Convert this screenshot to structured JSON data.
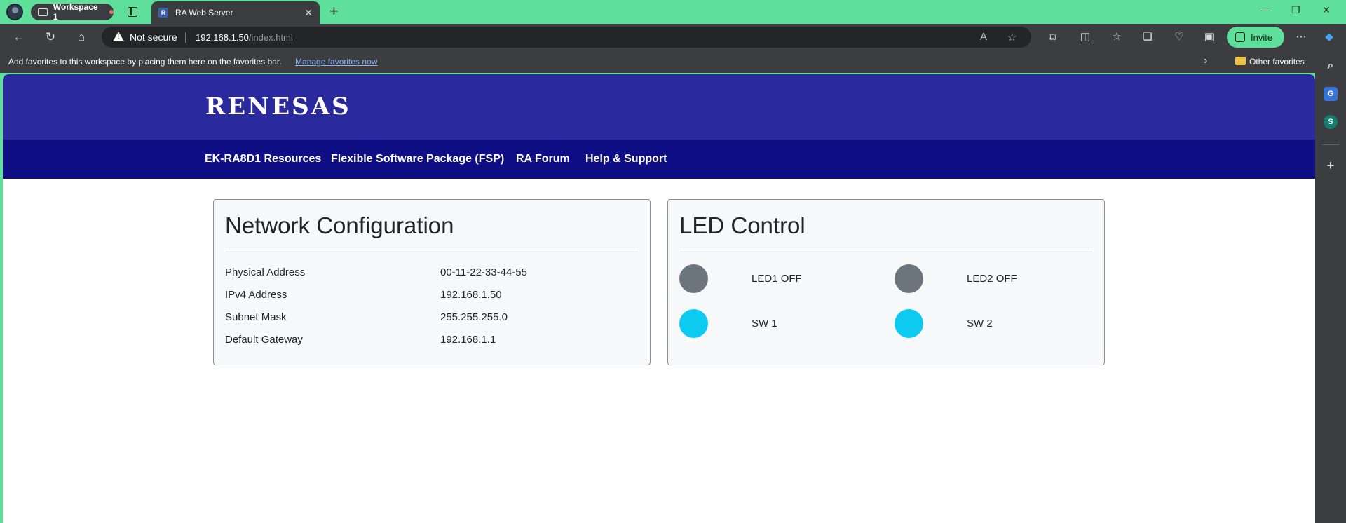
{
  "browser": {
    "workspace_label": "Workspace 1",
    "tab_title": "RA Web Server",
    "tab_favicon_text": "R",
    "security_label": "Not secure",
    "url_host": "192.168.1.50",
    "url_path": "/index.html",
    "invite_label": "Invite",
    "favorites_message": "Add favorites to this workspace by placing them here on the favorites bar.",
    "favorites_link": "Manage favorites now",
    "other_favorites": "Other favorites"
  },
  "site": {
    "logo_text": "RENESAS",
    "nav": [
      "EK-RA8D1 Resources",
      "Flexible Software Package (FSP)",
      "RA Forum",
      "Help & Support"
    ]
  },
  "network": {
    "title": "Network Configuration",
    "rows": [
      {
        "label": "Physical Address",
        "value": "00-11-22-33-44-55"
      },
      {
        "label": "IPv4 Address",
        "value": "192.168.1.50"
      },
      {
        "label": "Subnet Mask",
        "value": "255.255.255.0"
      },
      {
        "label": "Default Gateway",
        "value": "192.168.1.1"
      }
    ]
  },
  "led_control": {
    "title": "LED Control",
    "items": [
      {
        "label": "LED1 OFF",
        "color": "#6c757d"
      },
      {
        "label": "LED2 OFF",
        "color": "#6c757d"
      },
      {
        "label": "SW 1",
        "color": "#0dcaf0"
      },
      {
        "label": "SW 2",
        "color": "#0dcaf0"
      }
    ]
  },
  "colors": {
    "browser_accent": "#5ee09a",
    "hero": "#2a2a9e",
    "navbar": "#100e85"
  }
}
